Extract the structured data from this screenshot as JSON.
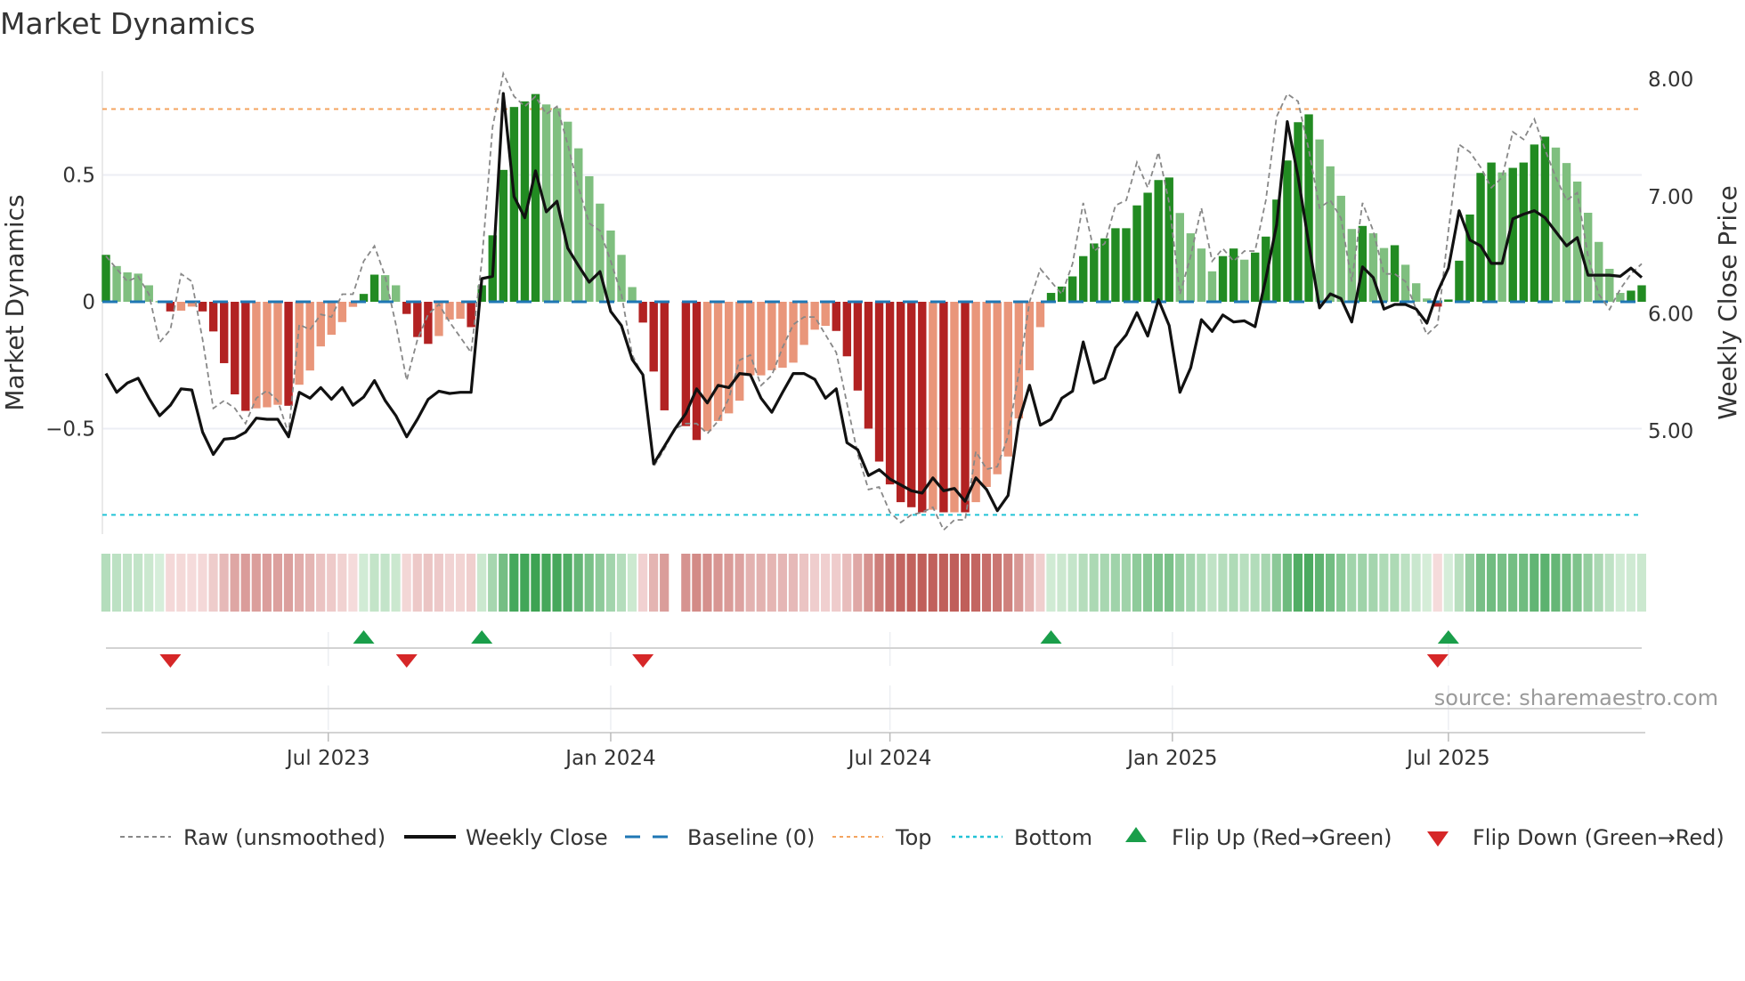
{
  "chart_data": {
    "type": "bar",
    "title": "Market Dynamics",
    "ylabel": "Market Dynamics",
    "y2label": "Weekly Close Price",
    "ylim": [
      -0.916,
      0.909
    ],
    "y2lim": [
      4.12,
      8.07
    ],
    "yticks": [
      {
        "value": 0.5,
        "label": "0.5"
      },
      {
        "value": 0,
        "label": "0"
      },
      {
        "value": -0.5,
        "label": "−0.5"
      }
    ],
    "y2ticks": [
      {
        "value": 8.0,
        "label": "8.00"
      },
      {
        "value": 7.0,
        "label": "7.00"
      },
      {
        "value": 6.0,
        "label": "6.00"
      },
      {
        "value": 5.0,
        "label": "5.00"
      }
    ],
    "xticks": [
      {
        "week_index": 20.7,
        "label": "Jul 2023"
      },
      {
        "week_index": 47.0,
        "label": "Jan 2024"
      },
      {
        "week_index": 73.0,
        "label": "Jul 2024"
      },
      {
        "week_index": 99.3,
        "label": "Jan 2025"
      },
      {
        "week_index": 125.0,
        "label": "Jul 2025"
      }
    ],
    "grid": true,
    "thresholds": {
      "top": 0.76,
      "bottom": -0.84,
      "baseline": 0
    },
    "oscillator": [
      0.185,
      0.141,
      0.116,
      0.111,
      0.065,
      0.003,
      -0.038,
      -0.035,
      -0.019,
      -0.038,
      -0.117,
      -0.242,
      -0.365,
      -0.43,
      -0.42,
      -0.416,
      -0.406,
      -0.41,
      -0.327,
      -0.271,
      -0.176,
      -0.13,
      -0.08,
      -0.02,
      0.031,
      0.107,
      0.105,
      0.065,
      -0.048,
      -0.139,
      -0.166,
      -0.135,
      -0.07,
      -0.067,
      -0.1,
      0.065,
      0.262,
      0.52,
      0.768,
      0.79,
      0.819,
      0.778,
      0.763,
      0.71,
      0.605,
      0.495,
      0.387,
      0.281,
      0.185,
      0.058,
      -0.082,
      -0.275,
      -0.428,
      null,
      -0.49,
      -0.545,
      -0.51,
      -0.47,
      -0.44,
      -0.39,
      -0.29,
      -0.29,
      -0.27,
      -0.26,
      -0.24,
      -0.17,
      -0.11,
      -0.095,
      -0.115,
      -0.215,
      -0.35,
      -0.5,
      -0.63,
      -0.72,
      -0.79,
      -0.81,
      -0.83,
      -0.82,
      -0.83,
      -0.83,
      -0.83,
      -0.79,
      -0.73,
      -0.68,
      -0.61,
      -0.46,
      -0.27,
      -0.1,
      0.035,
      0.06,
      0.1,
      0.18,
      0.23,
      0.25,
      0.29,
      0.29,
      0.38,
      0.43,
      0.48,
      0.49,
      0.35,
      0.27,
      0.21,
      0.12,
      0.18,
      0.21,
      0.166,
      0.194,
      0.257,
      0.403,
      0.557,
      0.708,
      0.739,
      0.64,
      0.534,
      0.418,
      0.287,
      0.299,
      0.27,
      0.212,
      0.223,
      0.146,
      0.073,
      0.013,
      -0.019,
      0.009,
      0.162,
      0.344,
      0.508,
      0.549,
      0.51,
      0.528,
      0.549,
      0.62,
      0.651,
      0.608,
      0.547,
      0.474,
      0.351,
      0.236,
      0.13,
      0.035,
      0.044,
      0.065
    ],
    "shade": "DLLLLLDLLDDDDDLLLDLLLLLLDDLLDDDLLLDDDDDDDLLLLLLLLLDDDLDDLLLLLLLLLLLLDDDDDDDDDLDLDLLLLLLLDDDDDDDDDDDDLLLLDDLDDDDDDLLLLDLLDLLLDDDDDDLDDDDLLLLLLLDD",
    "raw": [
      0.18,
      0.13,
      0.08,
      0.1,
      0.03,
      -0.16,
      -0.11,
      0.11,
      0.08,
      -0.15,
      -0.42,
      -0.39,
      -0.42,
      -0.48,
      -0.38,
      -0.35,
      -0.39,
      -0.52,
      -0.09,
      -0.11,
      -0.05,
      -0.06,
      0.03,
      0.03,
      0.16,
      0.22,
      0.1,
      -0.09,
      -0.31,
      -0.15,
      -0.05,
      -0.01,
      -0.08,
      -0.14,
      -0.2,
      0.16,
      0.69,
      0.9,
      0.81,
      0.77,
      0.81,
      0.74,
      0.77,
      0.62,
      0.45,
      0.31,
      0.28,
      0.16,
      0.03,
      -0.21,
      -0.29,
      -0.65,
      -0.58,
      -0.5,
      -0.48,
      -0.48,
      -0.52,
      -0.47,
      -0.38,
      -0.23,
      -0.21,
      -0.33,
      -0.29,
      -0.18,
      -0.09,
      -0.06,
      -0.06,
      -0.13,
      -0.2,
      -0.4,
      -0.6,
      -0.74,
      -0.73,
      -0.83,
      -0.87,
      -0.84,
      -0.83,
      -0.81,
      -0.9,
      -0.86,
      -0.86,
      -0.59,
      -0.66,
      -0.65,
      -0.53,
      -0.28,
      0.0,
      0.13,
      0.08,
      0.03,
      0.15,
      0.39,
      0.2,
      0.23,
      0.38,
      0.4,
      0.55,
      0.45,
      0.59,
      0.39,
      0.03,
      0.18,
      0.37,
      0.16,
      0.21,
      0.16,
      0.2,
      0.2,
      0.4,
      0.73,
      0.82,
      0.79,
      0.6,
      0.37,
      0.4,
      0.33,
      0.08,
      0.39,
      0.28,
      0.11,
      0.11,
      0.08,
      -0.03,
      -0.13,
      -0.09,
      0.28,
      0.62,
      0.59,
      0.53,
      0.45,
      0.49,
      0.67,
      0.64,
      0.72,
      0.6,
      0.49,
      0.4,
      0.43,
      0.18,
      0.03,
      -0.03,
      0.05,
      0.11,
      0.15
    ],
    "weekly_close": [
      5.49,
      5.33,
      5.41,
      5.45,
      5.28,
      5.13,
      5.22,
      5.36,
      5.35,
      4.99,
      4.8,
      4.93,
      4.94,
      4.99,
      5.11,
      5.1,
      5.1,
      4.95,
      5.33,
      5.28,
      5.37,
      5.27,
      5.37,
      5.22,
      5.29,
      5.43,
      5.26,
      5.13,
      4.95,
      5.1,
      5.27,
      5.34,
      5.32,
      5.33,
      5.33,
      6.3,
      6.32,
      7.88,
      7.0,
      6.82,
      7.22,
      6.87,
      6.96,
      6.56,
      6.41,
      6.27,
      6.36,
      6.02,
      5.9,
      5.61,
      5.48,
      4.72,
      4.87,
      5.02,
      5.15,
      5.36,
      5.24,
      5.39,
      5.37,
      5.49,
      5.48,
      5.28,
      5.16,
      5.33,
      5.49,
      5.49,
      5.44,
      5.28,
      5.36,
      4.9,
      4.84,
      4.62,
      4.67,
      4.59,
      4.54,
      4.49,
      4.47,
      4.6,
      4.49,
      4.51,
      4.4,
      4.6,
      4.5,
      4.32,
      4.45,
      5.08,
      5.39,
      5.05,
      5.1,
      5.28,
      5.34,
      5.76,
      5.41,
      5.45,
      5.71,
      5.82,
      6.01,
      5.81,
      6.12,
      5.9,
      5.33,
      5.54,
      5.95,
      5.85,
      5.99,
      5.93,
      5.94,
      5.89,
      6.3,
      6.76,
      7.64,
      7.17,
      6.6,
      6.05,
      6.17,
      6.13,
      5.93,
      6.4,
      6.31,
      6.04,
      6.08,
      6.08,
      6.04,
      5.92,
      6.19,
      6.39,
      6.88,
      6.63,
      6.58,
      6.43,
      6.43,
      6.81,
      6.85,
      6.88,
      6.82,
      6.7,
      6.58,
      6.65,
      6.33,
      6.33,
      6.33,
      6.32,
      6.39,
      6.31
    ],
    "flip_up_indices": [
      24,
      35,
      88,
      125
    ],
    "flip_down_indices": [
      6,
      28,
      50,
      124
    ],
    "colors": {
      "pos_strong": "#228b22",
      "pos_weak": "#7fbf7f",
      "neg_strong": "#b22222",
      "neg_weak": "#e9967a",
      "close": "#111111",
      "raw": "#888888",
      "baseline": "#1f77b4",
      "top": "#f4a460",
      "bottom": "#22c3d6",
      "flip_up": "#1a9e4a",
      "flip_down": "#d62728"
    },
    "legend": {
      "placement": "bottom",
      "items": [
        "Raw (unsmoothed)",
        "Weekly Close",
        "Baseline (0)",
        "Top",
        "Bottom",
        "Flip Up (Red→Green)",
        "Flip Down (Green→Red)"
      ]
    },
    "source": "source: sharemaestro.com"
  }
}
